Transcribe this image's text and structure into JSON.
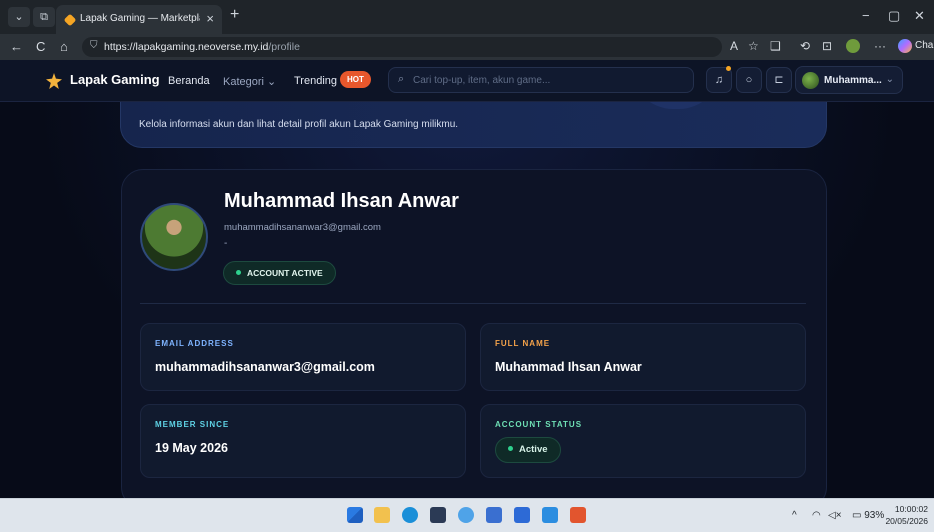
{
  "browser": {
    "tab_title": "Lapak Gaming — Marketplace Gar",
    "tab_close": "×",
    "new_tab": "+",
    "url_host": "https://lapakgaming.neoverse.my.id",
    "url_path": "/profile",
    "copilot_label": "Cha",
    "window_controls": {
      "minimize": "−",
      "maximize": "▢",
      "close": "✕"
    },
    "nav_icons": {
      "back": "←",
      "refresh": "C",
      "home": "⌂",
      "lock": "🔒"
    },
    "toolbar_icons": {
      "read_aloud": "A",
      "favorite": "☆",
      "collections": "❑",
      "history": "⟲",
      "screenshot": "⊡",
      "more": "···"
    }
  },
  "site": {
    "brand": "Lapak Gaming",
    "nav": {
      "home": "Beranda",
      "category": "Kategori",
      "trending": "Trending",
      "hot_badge": "HOT"
    },
    "search_placeholder": "Cari top-up, item, akun game...",
    "user_name": "Muhamma...",
    "icons": {
      "bell": "bell-icon",
      "chat": "chat-icon",
      "cart": "cart-icon",
      "search": "search-icon"
    }
  },
  "hero": {
    "subtitle": "Kelola informasi akun dan lihat detail profil akun Lapak Gaming milikmu."
  },
  "profile": {
    "name": "Muhammad Ihsan Anwar",
    "email": "muhammadihsananwar3@gmail.com",
    "bio": "-",
    "status_badge": "ACCOUNT ACTIVE"
  },
  "details": {
    "email_label": "EMAIL ADDRESS",
    "email_value": "muhammadihsananwar3@gmail.com",
    "fullname_label": "FULL NAME",
    "fullname_value": "Muhammad Ihsan Anwar",
    "member_label": "MEMBER SINCE",
    "member_value": "19 May 2026",
    "status_label": "ACCOUNT STATUS",
    "status_value": "Active"
  },
  "taskbar": {
    "battery": "93%",
    "time": "10:00:02",
    "date": "20/05/2026"
  },
  "colors": {
    "label_blue": "#7fb4ff",
    "label_orange": "#f5a34a",
    "label_cyan": "#5fd3e6",
    "label_green": "#6fe0b5",
    "active_green": "#2ed18e",
    "hot": "#e7572c"
  }
}
